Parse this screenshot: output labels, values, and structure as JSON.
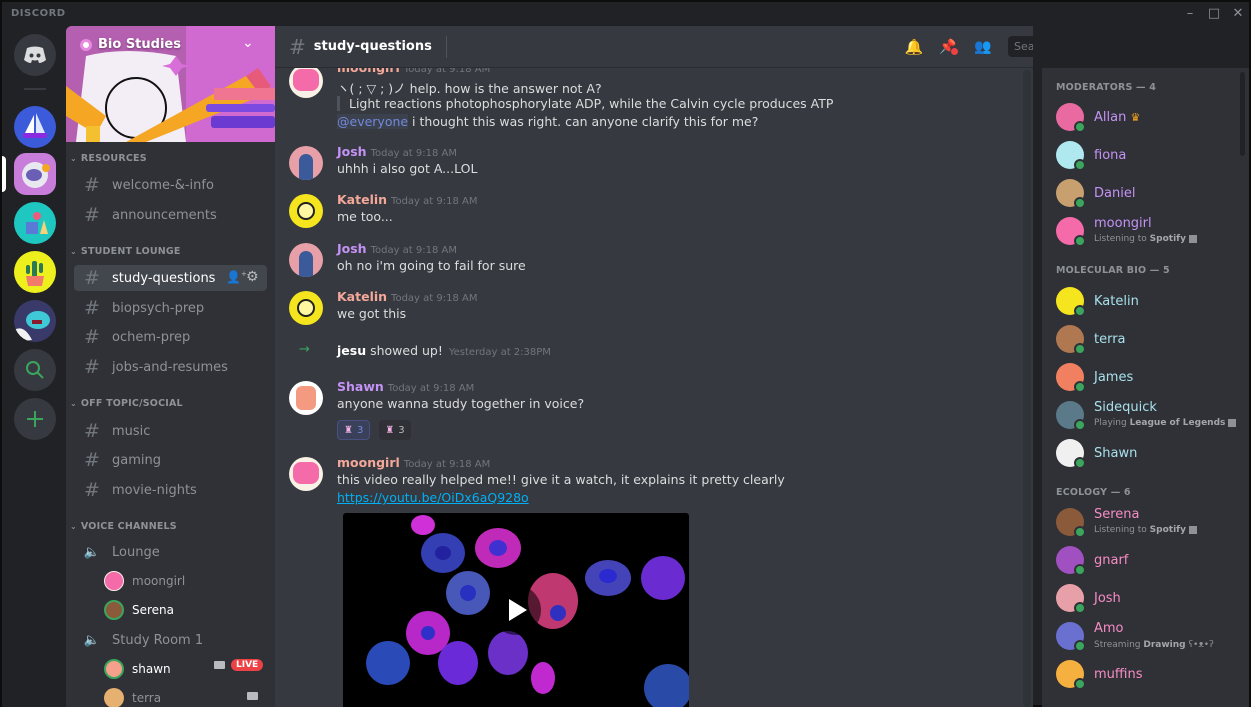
{
  "app": {
    "brand": "DISCORD",
    "window_controls": [
      "minimize",
      "maximize",
      "close"
    ]
  },
  "guilds": [
    {
      "name": "home",
      "icon": "discord-logo-icon"
    },
    {
      "name": "sailboat-server",
      "icon": "sailboat-icon"
    },
    {
      "name": "Bio Studies",
      "icon": "astronaut-icon",
      "selected": true
    },
    {
      "name": "art-server",
      "icon": "art-supplies-icon"
    },
    {
      "name": "plant-server",
      "icon": "cactus-icon"
    },
    {
      "name": "monster-server",
      "icon": "monster-icon"
    },
    {
      "name": "explore",
      "icon": "search-icon"
    },
    {
      "name": "add-server",
      "icon": "plus-icon"
    }
  ],
  "server": {
    "name": "Bio Studies",
    "badge_icon": "partner-badge-icon"
  },
  "categories": [
    {
      "name": "RESOURCES",
      "channels": [
        "welcome-&-info",
        "announcements"
      ]
    },
    {
      "name": "STUDENT LOUNGE",
      "channels": [
        "study-questions",
        "biopsych-prep",
        "ochem-prep",
        "jobs-and-resumes"
      ]
    },
    {
      "name": "OFF TOPIC/SOCIAL",
      "channels": [
        "music",
        "gaming",
        "movie-nights"
      ]
    },
    {
      "name": "VOICE CHANNELS"
    }
  ],
  "voice": [
    {
      "name": "Lounge",
      "users": [
        {
          "name": "moongirl",
          "speaking": false
        },
        {
          "name": "Serena",
          "speaking": true
        }
      ]
    },
    {
      "name": "Study Room 1",
      "users": [
        {
          "name": "shawn",
          "speaking": true,
          "video": true,
          "live": "LIVE"
        },
        {
          "name": "terra",
          "speaking": false,
          "video": true
        }
      ]
    }
  ],
  "channel": {
    "name": "study-questions",
    "search_placeholder": "Search"
  },
  "colors": {
    "josh": "#c493f5",
    "katelin": "#f4a89a",
    "moongirl": "#f4a89a",
    "shawn": "#c493f5",
    "mod": "#c493f5",
    "molbio": "#a8e0ec",
    "ecology": "#f78cc5",
    "link": "#00b0f4",
    "online": "#3ba55d",
    "live": "#ed4245"
  },
  "messages": [
    {
      "author": "moongirl",
      "time": "Today at 9:18 AM",
      "lines": [
        "ヽ( ; ▽ ; )ノ help. how is the answer not A?"
      ],
      "quote": "Light reactions photophosphorylate ADP, while the Calvin cycle produces ATP",
      "mention": "@everyone",
      "after_mention": " i thought this was right. can anyone clarify this for me?"
    },
    {
      "author": "Josh",
      "time": "Today at 9:18 AM",
      "text": "uhhh i also got A...LOL"
    },
    {
      "author": "Katelin",
      "time": "Today at 9:18 AM",
      "text": "me too..."
    },
    {
      "author": "Josh",
      "time": "Today at 9:18 AM",
      "text": "oh no i'm going to fail for sure"
    },
    {
      "author": "Katelin",
      "time": "Today at 9:18 AM",
      "text": "we got this"
    },
    {
      "system": true,
      "user": "jesu",
      "text": " showed up!",
      "time": "Yesterday at 2:38PM"
    },
    {
      "author": "Shawn",
      "time": "Today at 9:18 AM",
      "text": "anyone wanna study together in voice?",
      "reactions": [
        {
          "emoji": "cat-emoji",
          "count": "3",
          "reacted": true
        },
        {
          "emoji": "cat-emoji",
          "count": "3",
          "reacted": false
        }
      ]
    },
    {
      "author": "moongirl",
      "time": "Today at 9:18 AM",
      "text": "this video really helped me!! give it a watch, it explains it pretty clearly",
      "link": "https://youtu.be/OiDx6aQ928o",
      "embed": "video-thumbnail-cells"
    }
  ],
  "members": {
    "groups": [
      {
        "title": "MODERATORS — 4",
        "members": [
          {
            "name": "Allan",
            "crown": true
          },
          {
            "name": "fiona"
          },
          {
            "name": "Daniel"
          },
          {
            "name": "moongirl",
            "activity_prefix": "Listening to ",
            "activity": "Spotify"
          }
        ]
      },
      {
        "title": "MOLECULAR BIO — 5",
        "members": [
          {
            "name": "Katelin"
          },
          {
            "name": "terra"
          },
          {
            "name": "James"
          },
          {
            "name": "Sidequick",
            "activity_prefix": "Playing ",
            "activity": "League of Legends"
          },
          {
            "name": "Shawn"
          }
        ]
      },
      {
        "title": "ECOLOGY — 6",
        "members": [
          {
            "name": "Serena",
            "activity_prefix": "Listening to ",
            "activity": "Spotify"
          },
          {
            "name": "gnarf"
          },
          {
            "name": "Josh"
          },
          {
            "name": "Amo",
            "activity_prefix": "Streaming ",
            "activity": "Drawing",
            "activity_suffix": " ʕ•ᴥ•ʔ"
          },
          {
            "name": "muffins"
          }
        ]
      }
    ]
  }
}
